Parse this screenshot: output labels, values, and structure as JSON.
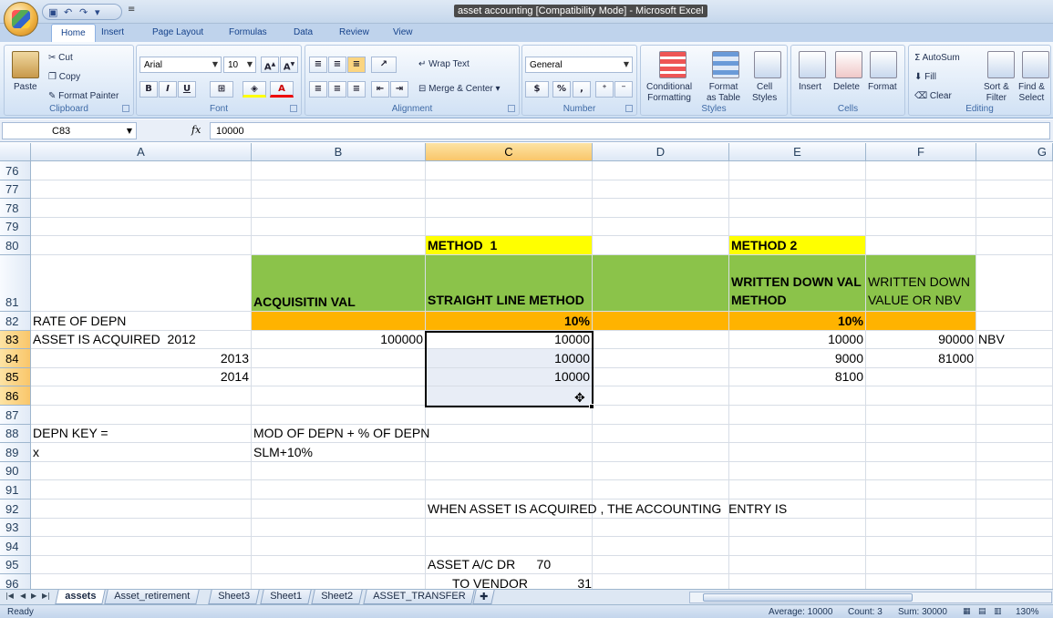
{
  "window": {
    "title": "asset accounting  [Compatibility Mode] - Microsoft Excel"
  },
  "ribbon": {
    "tabs": [
      "Home",
      "Insert",
      "Page Layout",
      "Formulas",
      "Data",
      "Review",
      "View"
    ],
    "clipboard": {
      "label": "Clipboard",
      "paste": "Paste",
      "cut": "Cut",
      "copy": "Copy",
      "format_painter": "Format Painter"
    },
    "font": {
      "label": "Font",
      "name": "Arial",
      "size": "10",
      "bold": "B",
      "italic": "I",
      "underline": "U"
    },
    "alignment": {
      "label": "Alignment",
      "wrap_text": "Wrap Text",
      "merge_center": "Merge & Center"
    },
    "number": {
      "label": "Number",
      "format": "General",
      "currency": "$",
      "percent": "%",
      "comma": ","
    },
    "styles": {
      "label": "Styles",
      "conditional": "Conditional\nFormatting",
      "format_table": "Format\nas Table",
      "cell_styles": "Cell\nStyles"
    },
    "cells": {
      "label": "Cells",
      "insert": "Insert",
      "delete": "Delete",
      "format": "Format"
    },
    "editing": {
      "label": "Editing",
      "autosum": "AutoSum",
      "fill": "Fill",
      "clear": "Clear",
      "sort_filter": "Sort &\nFilter",
      "find_select": "Find &\nSelect"
    }
  },
  "formula_bar": {
    "name_box": "C83",
    "fx": "fx",
    "value": "10000"
  },
  "columns": [
    "A",
    "B",
    "C",
    "D",
    "E",
    "F",
    "G"
  ],
  "rows": [
    {
      "num": "76",
      "cells": {}
    },
    {
      "num": "77",
      "cells": {}
    },
    {
      "num": "78",
      "cells": {}
    },
    {
      "num": "79",
      "cells": {}
    },
    {
      "num": "80",
      "cells": {
        "C": "METHOD  1",
        "E": "METHOD 2"
      }
    },
    {
      "num": "81",
      "cells": {
        "B": "ACQUISITIN VAL",
        "C": "STRAIGHT LINE METHOD",
        "E": "WRITTEN DOWN VAL METHOD",
        "F": "WRITTEN DOWN VALUE OR NBV"
      }
    },
    {
      "num": "82",
      "cells": {
        "A": "RATE OF DEPN",
        "C": "10%",
        "E": "10%"
      }
    },
    {
      "num": "83",
      "cells": {
        "A": "ASSET IS ACQUIRED  2012",
        "B": "100000",
        "C": "10000",
        "E": "10000",
        "F": "90000",
        "G": "NBV"
      }
    },
    {
      "num": "84",
      "cells": {
        "A": "2013",
        "C": "10000",
        "E": "9000",
        "F": "81000"
      }
    },
    {
      "num": "85",
      "cells": {
        "A": "2014",
        "C": "10000",
        "E": "8100"
      }
    },
    {
      "num": "86",
      "cells": {}
    },
    {
      "num": "87",
      "cells": {}
    },
    {
      "num": "88",
      "cells": {
        "A": "DEPN KEY =",
        "B": "MOD OF DEPN + % OF DEPN"
      }
    },
    {
      "num": "89",
      "cells": {
        "A": "x",
        "B": "SLM+10%"
      }
    },
    {
      "num": "90",
      "cells": {}
    },
    {
      "num": "91",
      "cells": {}
    },
    {
      "num": "92",
      "cells": {
        "C": "WHEN ASSET IS ACQUIRED , THE ACCOUNTING  ENTRY IS"
      }
    },
    {
      "num": "93",
      "cells": {}
    },
    {
      "num": "94",
      "cells": {}
    },
    {
      "num": "95",
      "cells": {
        "C": "ASSET A/C DR      70"
      }
    },
    {
      "num": "96",
      "cells": {
        "C": "       TO VENDOR              31"
      }
    }
  ],
  "sheets": [
    "assets",
    "Asset_retirement",
    "Sheet3",
    "Sheet1",
    "Sheet2",
    "ASSET_TRANSFER"
  ],
  "active_sheet": "assets",
  "status": {
    "ready": "Ready",
    "average": "Average: 10000",
    "count": "Count: 3",
    "sum": "Sum: 30000",
    "zoom": "130%"
  },
  "colors": {
    "yellow": "#ffff00",
    "green": "#8bc34a",
    "orange": "#ffb300"
  }
}
